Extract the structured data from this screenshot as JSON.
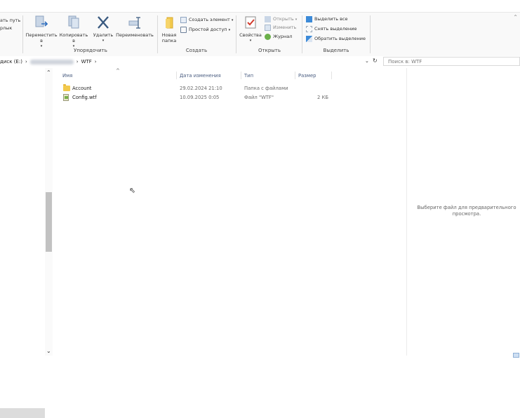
{
  "ribbon": {
    "clipboard_partial": {
      "line1": "ать путь",
      "line2": "рлык"
    },
    "organize": {
      "move_to": "Переместить в",
      "copy_to": "Копировать в",
      "delete": "Удалить",
      "rename": "Переименовать",
      "group_label": "Упорядочить"
    },
    "create": {
      "new_folder": "Новая папка",
      "new_item": "Создать элемент",
      "easy_access": "Простой доступ",
      "group_label": "Создать"
    },
    "open": {
      "properties": "Свойства",
      "open": "Открыть",
      "edit": "Изменить",
      "history": "Журнал",
      "group_label": "Открыть"
    },
    "select": {
      "select_all": "Выделить все",
      "select_none": "Снять выделение",
      "invert": "Обратить выделение",
      "group_label": "Выделить"
    }
  },
  "address": {
    "drive": "диск (E:)",
    "current_folder": "WTF",
    "search_placeholder": "Поиск в: WTF"
  },
  "columns": {
    "name": "Имя",
    "date": "Дата изменения",
    "type": "Тип",
    "size": "Размер"
  },
  "files": [
    {
      "name": "Account",
      "date": "29.02.2024 21:10",
      "type": "Папка с файлами",
      "size": "",
      "icon": "folder-icon"
    },
    {
      "name": "Config.wtf",
      "date": "10.09.2025 0:05",
      "type": "Файл \"WTF\"",
      "size": "2 КБ",
      "icon": "file-icon"
    }
  ],
  "preview": {
    "message_line1": "Выберите файл для предварительного",
    "message_line2": "просмотра."
  }
}
